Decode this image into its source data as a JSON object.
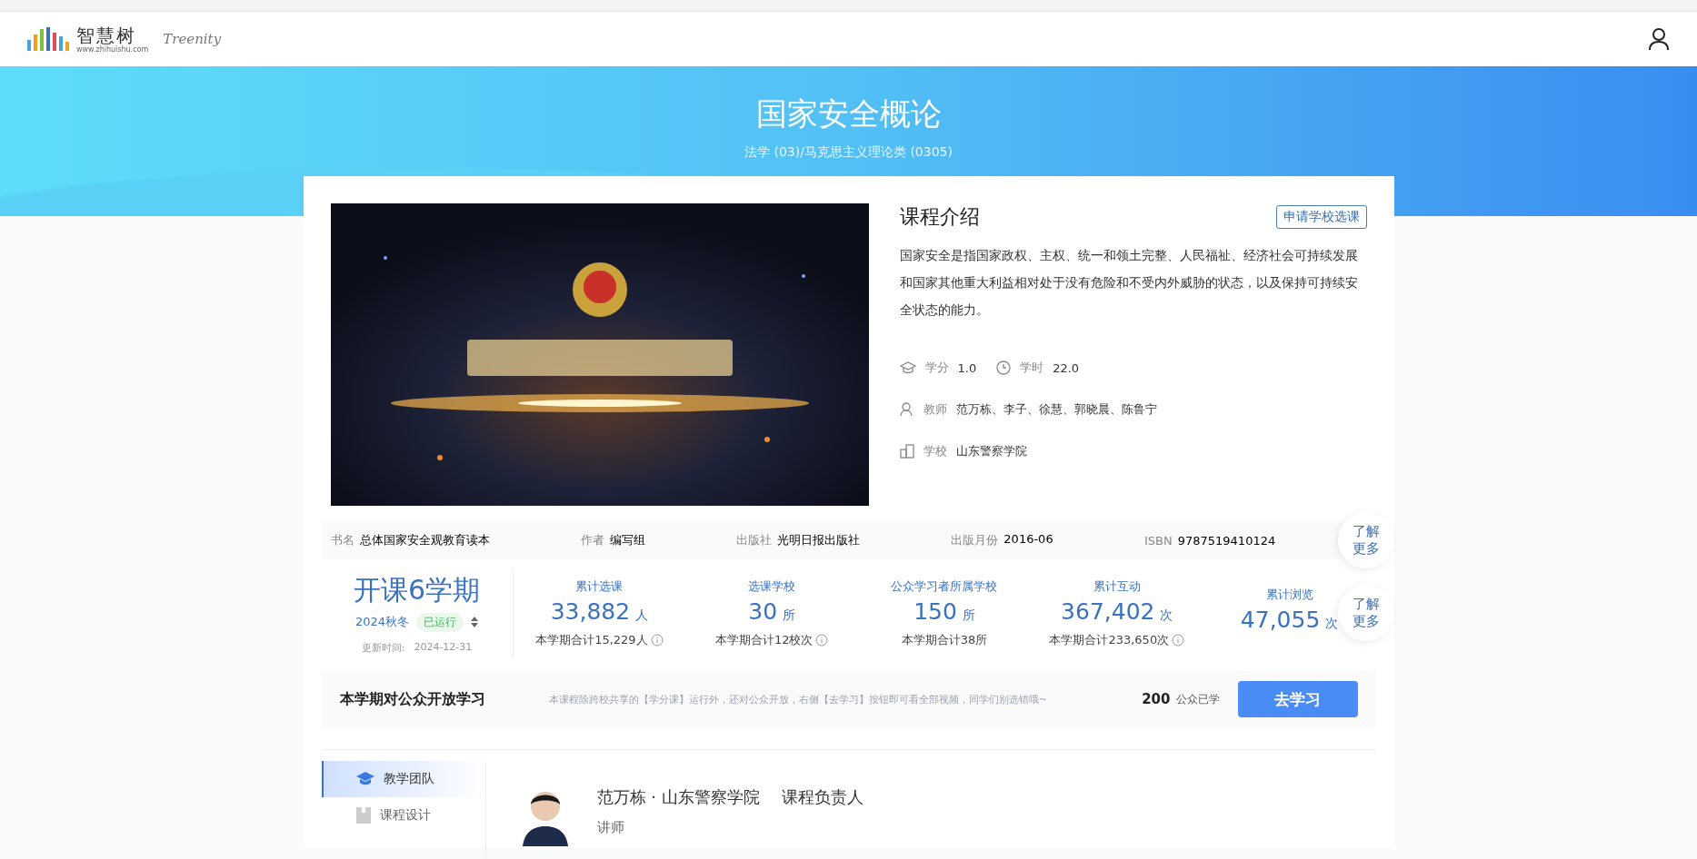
{
  "header": {
    "logo_text": "智慧树",
    "logo_sub": "www.zhihuishu.com",
    "brand": "Treenity"
  },
  "banner": {
    "title": "国家安全概论",
    "subtitle": "法学 (03)/马克思主义理论类 (0305)"
  },
  "course": {
    "intro_title": "课程介绍",
    "apply_button": "申请学校选课",
    "description": "国家安全是指国家政权、主权、统一和领土完整、人民福祉、经济社会可持续发展和国家其他重大利益相对处于没有危险和不受内外威胁的状态，以及保持可持续安全状态的能力。",
    "credit_label": "学分",
    "credit": "1.0",
    "hours_label": "学时",
    "hours": "22.0",
    "teacher_label": "教师",
    "teachers": "范万栋、李子、徐慧、郭晓晨、陈鲁宁",
    "school_label": "学校",
    "school": "山东警察学院"
  },
  "book": {
    "fields": [
      {
        "label": "书名",
        "value": "总体国家安全观教育读本"
      },
      {
        "label": "作者",
        "value": "编写组"
      },
      {
        "label": "出版社",
        "value": "光明日报出版社"
      },
      {
        "label": "出版月份",
        "value": "2016-06"
      },
      {
        "label": "ISBN",
        "value": "9787519410124"
      }
    ],
    "more": "了解更多"
  },
  "stats": {
    "terms": "开课6学期",
    "term": "2024秋冬",
    "status": "已运行",
    "updated_label": "更新时间:",
    "updated": "2024-12-31",
    "items": [
      {
        "label": "累计选课",
        "value": "33,882",
        "unit": "人",
        "note": "本学期合计15,229人",
        "info": true
      },
      {
        "label": "选课学校",
        "value": "30",
        "unit": "所",
        "note": "本学期合计12校次",
        "info": true
      },
      {
        "label": "公众学习者所属学校",
        "value": "150",
        "unit": "所",
        "note": "本学期合计38所",
        "info": false
      },
      {
        "label": "累计互动",
        "value": "367,402",
        "unit": "次",
        "note": "本学期合计233,650次",
        "info": true
      },
      {
        "label": "累计浏览",
        "value": "47,055",
        "unit": "次"
      }
    ],
    "more": "了解更多"
  },
  "public": {
    "title": "本学期对公众开放学习",
    "hint": "本课程除跨校共享的【学分课】运行外，还对公众开放，右侧【去学习】按钮即可看全部视频，同学们别选错哦~",
    "count": "200",
    "count_label": "公众已学",
    "button": "去学习"
  },
  "sidebar": {
    "items": [
      {
        "label": "教学团队",
        "selected": true
      },
      {
        "label": "课程设计",
        "selected": false
      }
    ]
  },
  "teacher": {
    "name": "范万栋 · 山东警察学院",
    "role": "课程负责人",
    "title": "讲师"
  }
}
